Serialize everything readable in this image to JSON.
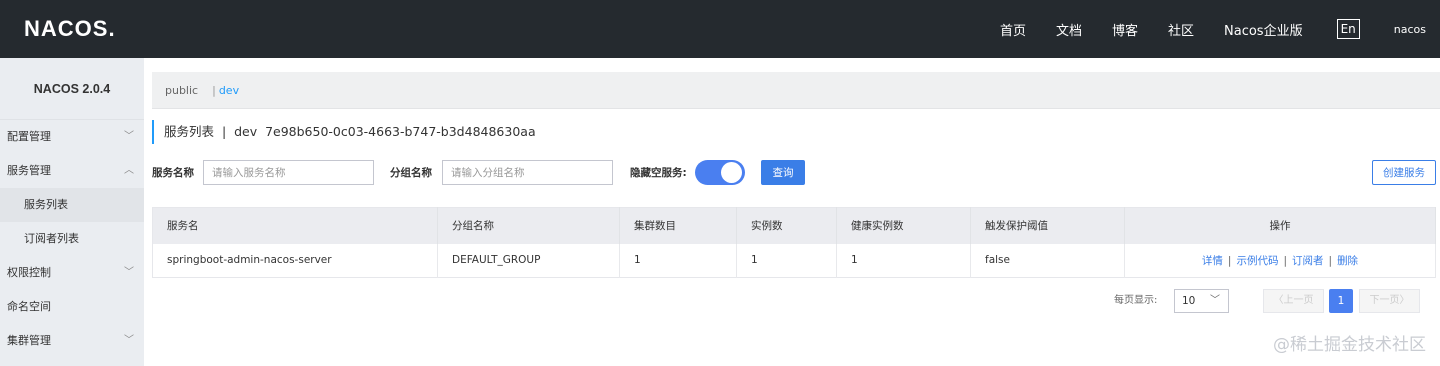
{
  "header": {
    "logo": "NACOS.",
    "nav": [
      "首页",
      "文档",
      "博客",
      "社区",
      "Nacos企业版"
    ],
    "lang": "En",
    "user": "nacos"
  },
  "sidebar": {
    "title": "NACOS 2.0.4",
    "items": [
      {
        "label": "配置管理",
        "chevron": "﹀"
      },
      {
        "label": "服务管理",
        "chevron": "︿"
      },
      {
        "label": "服务列表"
      },
      {
        "label": "订阅者列表"
      },
      {
        "label": "权限控制",
        "chevron": "﹀"
      },
      {
        "label": "命名空间"
      },
      {
        "label": "集群管理",
        "chevron": "﹀"
      }
    ]
  },
  "namespace": {
    "public": "public",
    "sep": "|",
    "dev": "dev"
  },
  "page": {
    "title": "服务列表  |  dev  7e98b650-0c03-4663-b747-b3d4848630aa"
  },
  "filters": {
    "service_name_label": "服务名称",
    "service_name_placeholder": "请输入服务名称",
    "group_name_label": "分组名称",
    "group_name_placeholder": "请输入分组名称",
    "hide_empty_label": "隐藏空服务:",
    "hide_empty_on": true,
    "query_button": "查询",
    "create_button": "创建服务"
  },
  "table": {
    "columns": [
      "服务名",
      "分组名称",
      "集群数目",
      "实例数",
      "健康实例数",
      "触发保护阈值",
      "操作"
    ],
    "rows": [
      {
        "service": "springboot-admin-nacos-server",
        "group": "DEFAULT_GROUP",
        "clusters": "1",
        "instances": "1",
        "healthy": "1",
        "protect": "false",
        "ops": [
          "详情",
          "示例代码",
          "订阅者",
          "删除"
        ]
      }
    ]
  },
  "pagination": {
    "page_size_label": "每页显示:",
    "page_size": "10",
    "prev": "上一页",
    "current": "1",
    "next": "下一页"
  },
  "watermark": "@稀土掘金技术社区",
  "colors": {
    "topbar": "#252a2f",
    "accent": "#3a7ee7",
    "sidebar": "#eaedf1"
  }
}
